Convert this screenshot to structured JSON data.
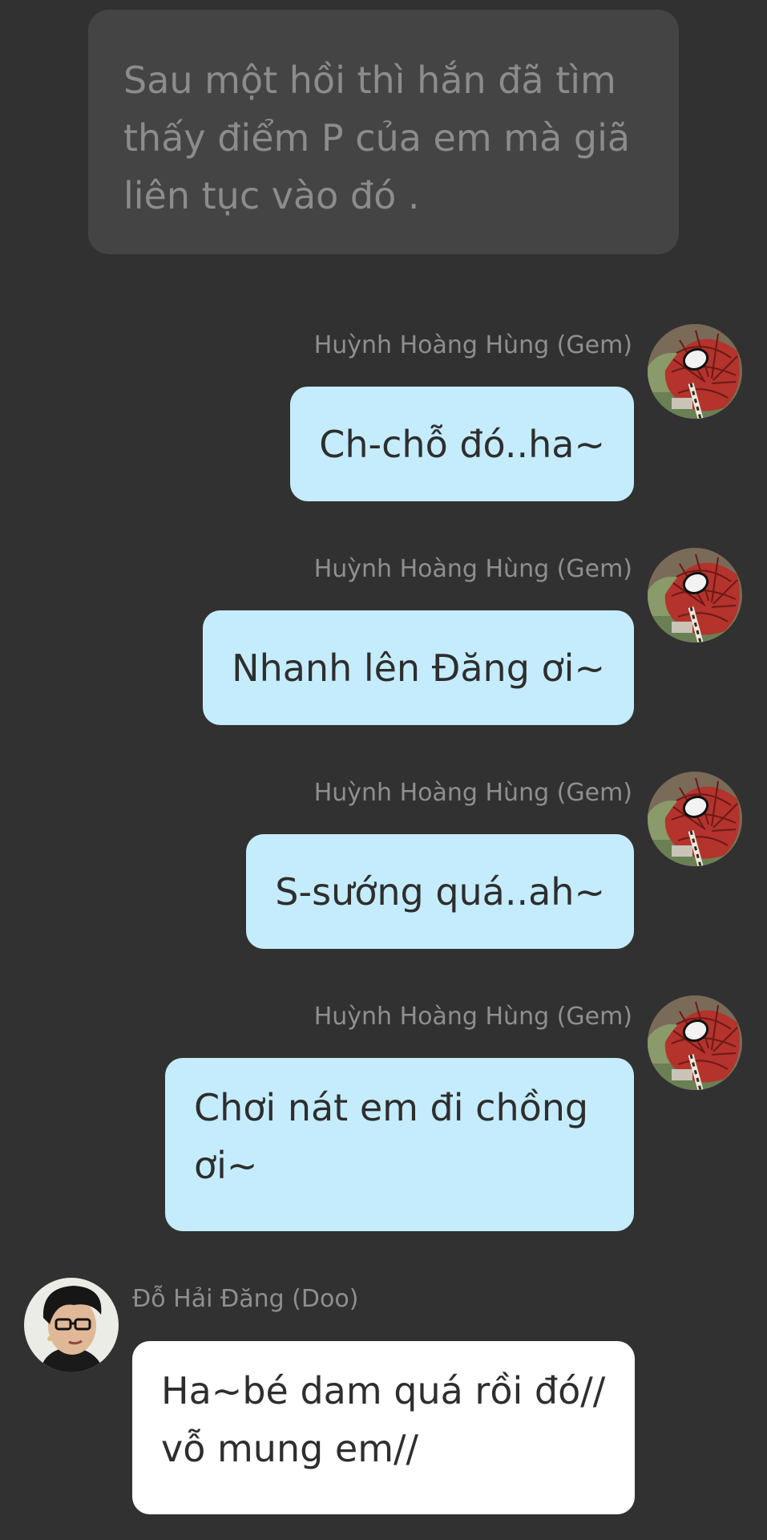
{
  "narration": {
    "text": "Sau một hồi thì hắn đã tìm thấy điểm P của em mà giã liên tục vào đó ."
  },
  "messages": [
    {
      "sender": "Huỳnh Hoàng Hùng (Gem)",
      "text": "Ch-chỗ đó..ha~",
      "side": "right",
      "avatar": "spiderman-avatar"
    },
    {
      "sender": "Huỳnh Hoàng Hùng (Gem)",
      "text": "Nhanh lên Đăng ơi~",
      "side": "right",
      "avatar": "spiderman-avatar"
    },
    {
      "sender": "Huỳnh Hoàng Hùng (Gem)",
      "text": "S-sướng quá..ah~",
      "side": "right",
      "avatar": "spiderman-avatar"
    },
    {
      "sender": "Huỳnh Hoàng Hùng (Gem)",
      "text": "Chơi nát em đi chồng ơi~",
      "side": "right",
      "avatar": "spiderman-avatar"
    },
    {
      "sender": "Đỗ Hải Đăng (Doo)",
      "text": "Ha~bé dam quá rồi đó// vỗ mung em//",
      "side": "left",
      "avatar": "man-with-glasses-avatar"
    }
  ],
  "colors": {
    "background": "#313131",
    "narration_bubble": "#444444",
    "right_bubble": "#c5ecfc",
    "left_bubble": "#ffffff",
    "sender_name": "#8f8f8f"
  }
}
